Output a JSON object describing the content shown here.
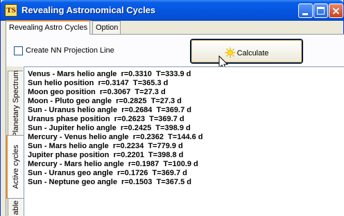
{
  "window": {
    "title": "Revealing Astronomical Cycles",
    "icon_letters": "TS",
    "buttons": [
      "minimize-icon",
      "maximize-icon",
      "close-icon"
    ]
  },
  "tabs": [
    {
      "label": "Revealing Astro Cycles",
      "active": true
    },
    {
      "label": "Option",
      "active": false
    }
  ],
  "options": {
    "checkbox_label": "Create NN Projection Line",
    "checkbox_checked": false,
    "calculate_label": "Calculate"
  },
  "side_tabs": [
    {
      "label": "Planetary Spectrum",
      "active": false
    },
    {
      "label": "Active cycles",
      "active": true
    },
    {
      "label": "able",
      "active": false
    }
  ],
  "results": [
    "Venus - Mars helio angle  r=0.3310  T=333.9 d",
    "Sun helio position  r=0.3147  T=365.3 d",
    "Moon geo position  r=0.3067  T=27.3 d",
    "Moon - Pluto geo angle  r=0.2825  T=27.3 d",
    "Sun - Uranus helio angle  r=0.2684  T=369.7 d",
    "Uranus phase position  r=0.2623  T=369.7 d",
    "Sun - Jupiter helio angle  r=0.2425  T=398.9 d",
    "Mercury - Venus helio angle  r=0.2362  T=144.6 d",
    "Sun - Mars helio angle  r=0.2234  T=779.9 d",
    "Jupiter phase position  r=0.2201  T=398.8 d",
    "Mercury - Mars helio angle  r=0.1987  T=100.9 d",
    "Sun - Uranus geo angle  r=0.1726  T=369.7 d",
    "Sun - Neptune geo angle  r=0.1503  T=367.5 d"
  ],
  "colors": {
    "titlebar": "#0555e0",
    "active_tab_accent": "#e68b2c",
    "face": "#ece9d8"
  }
}
